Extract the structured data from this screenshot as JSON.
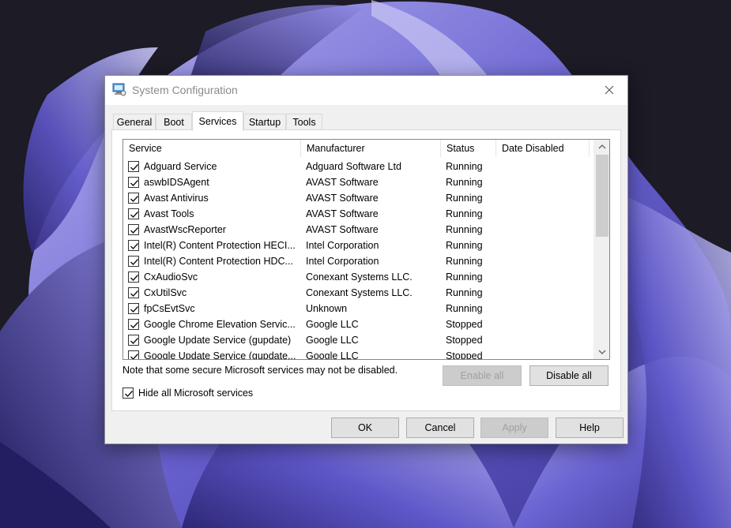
{
  "window": {
    "title": "System Configuration",
    "tabs": [
      "General",
      "Boot",
      "Services",
      "Startup",
      "Tools"
    ],
    "active_tab": "Services"
  },
  "services": {
    "columns": [
      "Service",
      "Manufacturer",
      "Status",
      "Date Disabled"
    ],
    "rows": [
      {
        "service": "Adguard Service",
        "manufacturer": "Adguard Software Ltd",
        "status": "Running",
        "date_disabled": "",
        "checked": true
      },
      {
        "service": "aswbIDSAgent",
        "manufacturer": "AVAST Software",
        "status": "Running",
        "date_disabled": "",
        "checked": true
      },
      {
        "service": "Avast Antivirus",
        "manufacturer": "AVAST Software",
        "status": "Running",
        "date_disabled": "",
        "checked": true
      },
      {
        "service": "Avast Tools",
        "manufacturer": "AVAST Software",
        "status": "Running",
        "date_disabled": "",
        "checked": true
      },
      {
        "service": "AvastWscReporter",
        "manufacturer": "AVAST Software",
        "status": "Running",
        "date_disabled": "",
        "checked": true
      },
      {
        "service": "Intel(R) Content Protection HECI...",
        "manufacturer": "Intel Corporation",
        "status": "Running",
        "date_disabled": "",
        "checked": true
      },
      {
        "service": "Intel(R) Content Protection HDC...",
        "manufacturer": "Intel Corporation",
        "status": "Running",
        "date_disabled": "",
        "checked": true
      },
      {
        "service": "CxAudioSvc",
        "manufacturer": "Conexant Systems LLC.",
        "status": "Running",
        "date_disabled": "",
        "checked": true
      },
      {
        "service": "CxUtilSvc",
        "manufacturer": "Conexant Systems LLC.",
        "status": "Running",
        "date_disabled": "",
        "checked": true
      },
      {
        "service": "fpCsEvtSvc",
        "manufacturer": "Unknown",
        "status": "Running",
        "date_disabled": "",
        "checked": true
      },
      {
        "service": "Google Chrome Elevation Servic...",
        "manufacturer": "Google LLC",
        "status": "Stopped",
        "date_disabled": "",
        "checked": true
      },
      {
        "service": "Google Update Service (gupdate)",
        "manufacturer": "Google LLC",
        "status": "Stopped",
        "date_disabled": "",
        "checked": true
      },
      {
        "service": "Google Update Service (gupdate...",
        "manufacturer": "Google LLC",
        "status": "Stopped",
        "date_disabled": "",
        "checked": true
      }
    ]
  },
  "note": "Note that some secure Microsoft services may not be disabled.",
  "buttons": {
    "enable_all": "Enable all",
    "disable_all": "Disable all",
    "ok": "OK",
    "cancel": "Cancel",
    "apply": "Apply",
    "help": "Help"
  },
  "hide_ms": {
    "label": "Hide all Microsoft services",
    "checked": true
  },
  "icons": {
    "app": "system-configuration-icon",
    "close": "close-icon",
    "scroll_up": "chevron-up-icon",
    "scroll_down": "chevron-down-icon"
  }
}
